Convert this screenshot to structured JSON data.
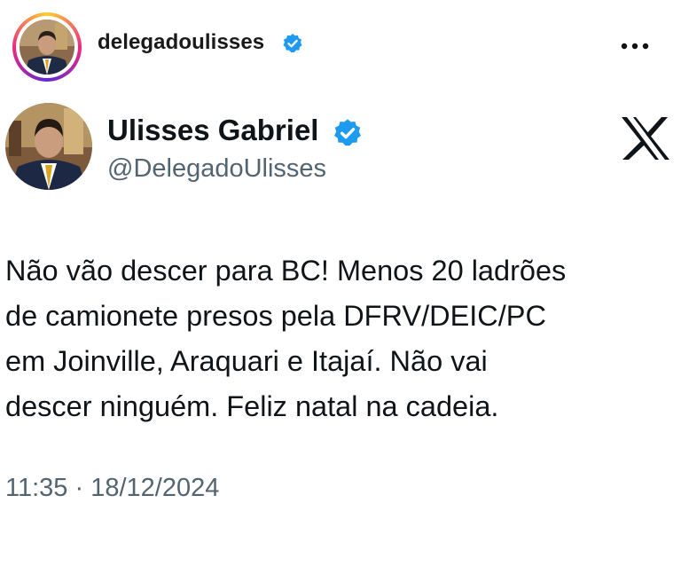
{
  "instagram_header": {
    "username": "delegadoulisses",
    "verified_icon": "verified-badge-icon",
    "more_icon": "more-options-icon",
    "ring_colors": [
      "#f9ce34",
      "#ee2a7b",
      "#6228d7"
    ]
  },
  "tweet": {
    "display_name": "Ulisses Gabriel",
    "handle": "@DelegadoUlisses",
    "verified_icon": "verified-badge-icon",
    "platform_logo": "x-logo-icon",
    "text_lines": [
      "Não vão descer para BC! Menos 20 ladrões",
      "de camionete presos pela DFRV/DEIC/PC",
      "em Joinville, Araquari e Itajaí. Não vai",
      "descer ninguém. Feliz natal na cadeia."
    ],
    "timestamp": "11:35 · 18/12/2024"
  },
  "colors": {
    "verified_blue": "#1d9bf0",
    "text_primary": "#0f1419",
    "text_secondary": "#536471"
  }
}
